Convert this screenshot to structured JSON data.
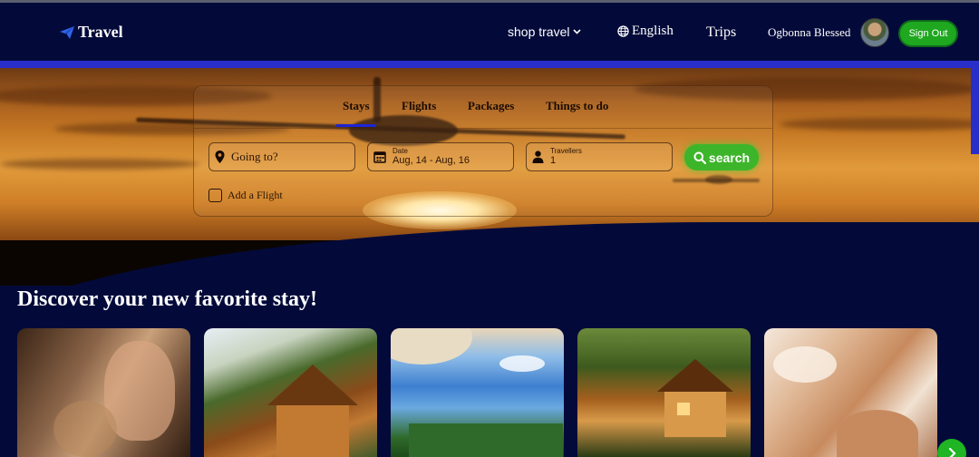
{
  "header": {
    "logo_text": "Travel",
    "shop_label": "shop travel",
    "language_label": "English",
    "trips_label": "Trips",
    "user_name": "Ogbonna Blessed",
    "signout_label": "Sign Out"
  },
  "search": {
    "tabs": [
      {
        "label": "Stays",
        "active": true
      },
      {
        "label": "Flights",
        "active": false
      },
      {
        "label": "Packages",
        "active": false
      },
      {
        "label": "Things to do",
        "active": false
      }
    ],
    "destination_placeholder": "Going to?",
    "date_label": "Date",
    "date_value": "Aug, 14 - Aug, 16",
    "travellers_label": "Travellers",
    "travellers_value": "1",
    "search_button": "search",
    "add_flight_label": "Add a Flight"
  },
  "discover": {
    "title": "Discover your new favorite stay!"
  },
  "colors": {
    "background": "#030a3a",
    "accent_green": "#1fa81f",
    "tab_underline": "#1c24d8",
    "hero_bar": "#2a2ec9"
  },
  "icons": {
    "logo": "paper-plane-icon",
    "shop_chevron": "chevron-down-icon",
    "language": "globe-icon",
    "destination": "map-pin-icon",
    "date": "calendar-icon",
    "travellers": "person-icon",
    "search": "magnifier-icon",
    "next": "chevron-right-icon"
  }
}
